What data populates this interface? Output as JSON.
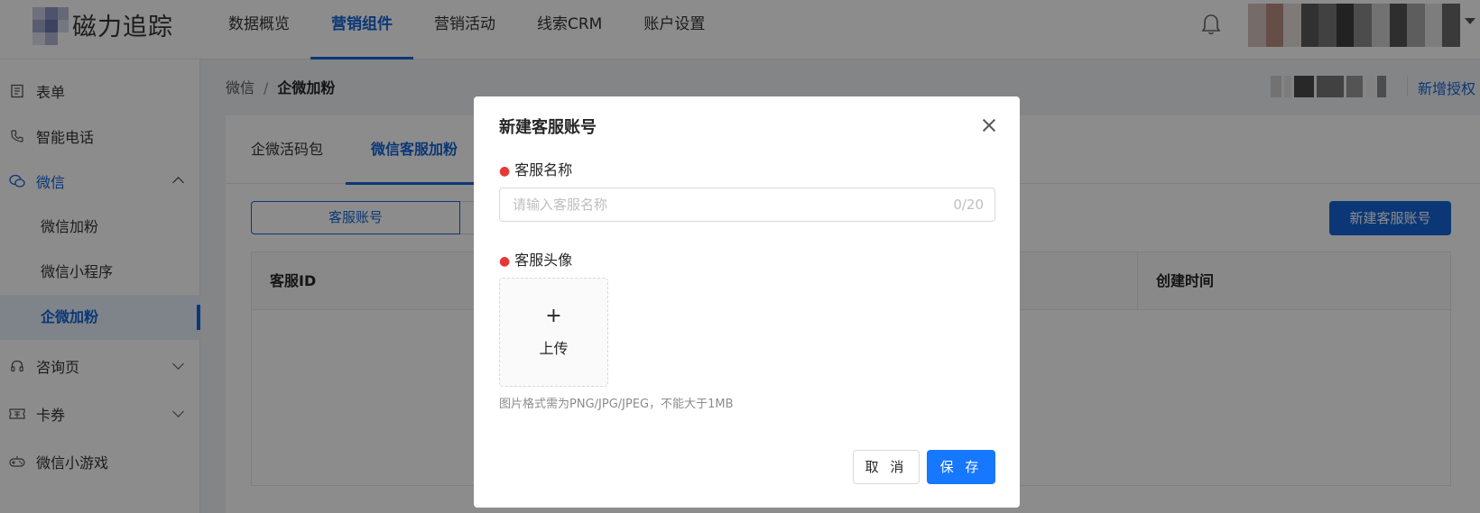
{
  "app": {
    "logo_text": "磁力追踪"
  },
  "topnav": {
    "items": [
      {
        "label": "数据概览"
      },
      {
        "label": "营销组件"
      },
      {
        "label": "营销活动"
      },
      {
        "label": "线索CRM"
      },
      {
        "label": "账户设置"
      }
    ],
    "active_index": 1
  },
  "sidebar": {
    "items": [
      {
        "label": "表单",
        "icon": "form-icon"
      },
      {
        "label": "智能电话",
        "icon": "phone-icon"
      },
      {
        "label": "微信",
        "icon": "wechat-icon",
        "expanded": true
      },
      {
        "label": "微信加粉"
      },
      {
        "label": "微信小程序"
      },
      {
        "label": "企微加粉",
        "active": true
      },
      {
        "label": "咨询页",
        "icon": "headset-icon"
      },
      {
        "label": "卡券",
        "icon": "ticket-icon"
      },
      {
        "label": "微信小游戏",
        "icon": "gamepad-icon"
      }
    ]
  },
  "breadcrumb": {
    "parent": "微信",
    "separator": "/",
    "current": "企微加粉"
  },
  "header_actions": {
    "new_auth": "新增授权"
  },
  "page_tabs": [
    {
      "label": "企微活码包"
    },
    {
      "label": "微信客服加粉",
      "active": true
    }
  ],
  "segment": {
    "selected": "客服账号"
  },
  "toolbar": {
    "new_account_button": "新建客服账号"
  },
  "table": {
    "columns": [
      "客服ID",
      "创建时间"
    ]
  },
  "modal": {
    "title": "新建客服账号",
    "name_field": {
      "label": "客服名称",
      "placeholder": "请输入客服名称",
      "value": "",
      "counter": "0/20"
    },
    "avatar_field": {
      "label": "客服头像",
      "upload_plus": "+",
      "upload_label": "上传",
      "hint": "图片格式需为PNG/JPG/JPEG，不能大于1MB"
    },
    "cancel_button": "取 消",
    "save_button": "保 存"
  },
  "colors": {
    "brand": "#1565d8",
    "primary_button": "#1677ff",
    "required": "#e53935",
    "overlay": "rgba(0,0,0,0.45)"
  }
}
